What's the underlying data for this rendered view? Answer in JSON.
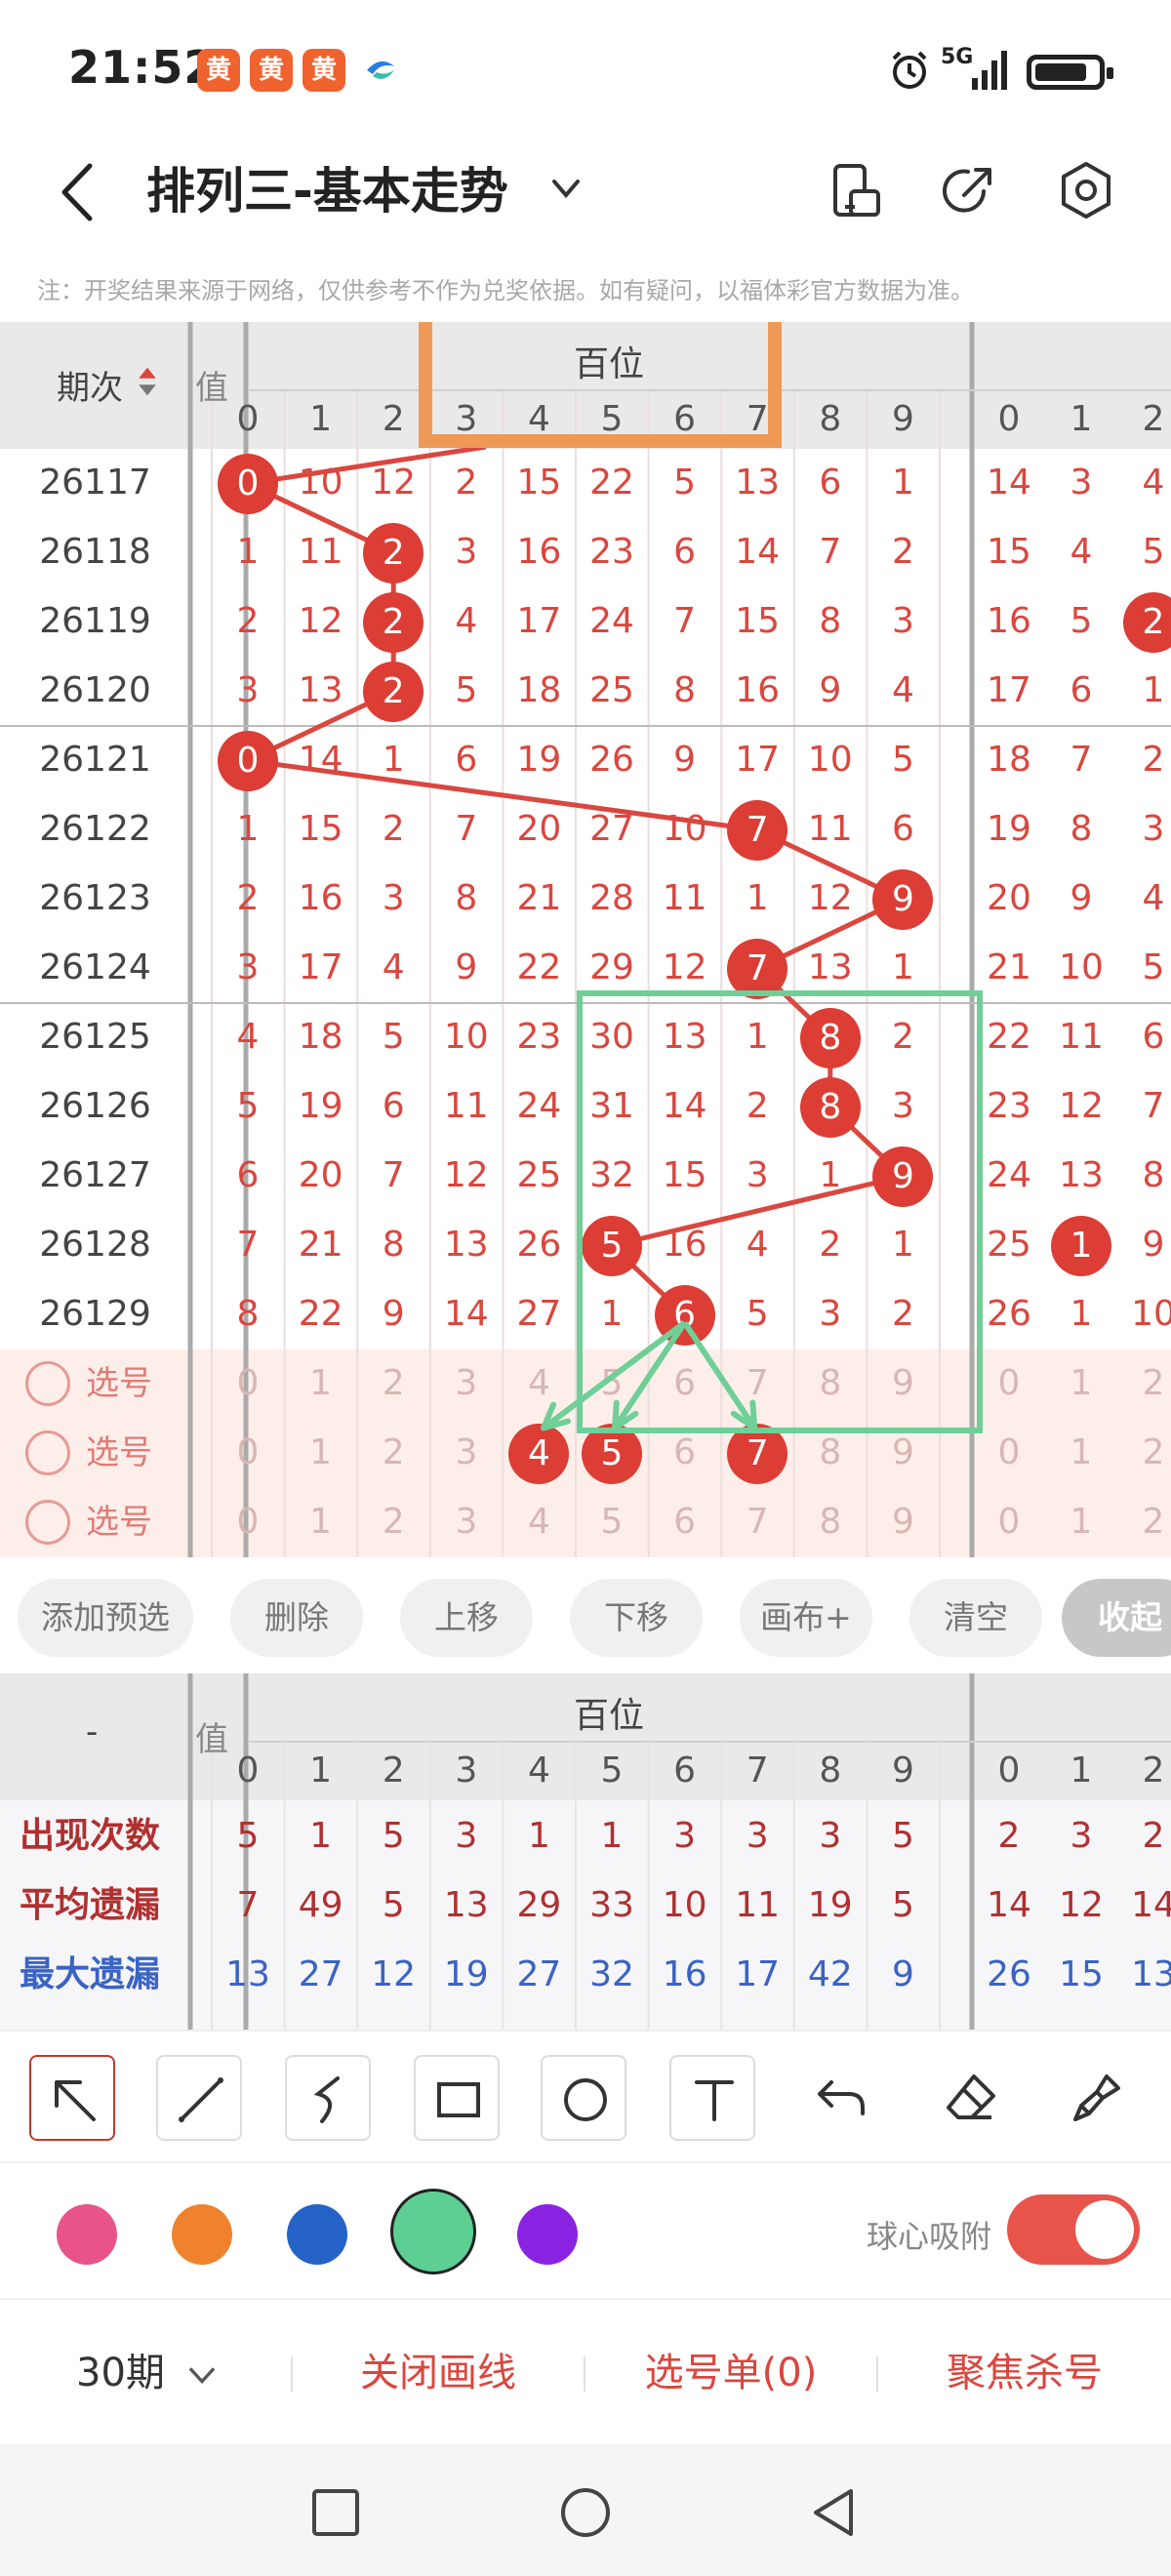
{
  "status": {
    "time": "21:52",
    "network": "5G",
    "app_icons": [
      "黄",
      "黄",
      "黄"
    ]
  },
  "header": {
    "title": "排列三-基本走势",
    "note": "注：开奖结果来源于网络，仅供参考不作为兑奖依据。如有疑问，以福体彩官方数据为准。"
  },
  "trend": {
    "period_header": "期次",
    "value_header_partial": "值",
    "group_header": "百位",
    "digits": [
      "0",
      "1",
      "2",
      "3",
      "4",
      "5",
      "6",
      "7",
      "8",
      "9"
    ],
    "next_digits": [
      "0",
      "1",
      "2"
    ],
    "rows": [
      {
        "period": "26117",
        "hundreds": [
          0,
          10,
          12,
          2,
          15,
          22,
          5,
          13,
          6,
          1
        ],
        "next": [
          14,
          3,
          4
        ],
        "hit": 0
      },
      {
        "period": "26118",
        "hundreds": [
          1,
          11,
          2,
          3,
          16,
          23,
          6,
          14,
          7,
          2
        ],
        "next": [
          15,
          4,
          5
        ],
        "hit": 2
      },
      {
        "period": "26119",
        "hundreds": [
          2,
          12,
          2,
          4,
          17,
          24,
          7,
          15,
          8,
          3
        ],
        "next": [
          16,
          5,
          2
        ],
        "hit": 2
      },
      {
        "period": "26120",
        "hundreds": [
          3,
          13,
          2,
          5,
          18,
          25,
          8,
          16,
          9,
          4
        ],
        "next": [
          17,
          6,
          1
        ],
        "hit": 2
      },
      {
        "period": "26121",
        "hundreds": [
          0,
          14,
          1,
          6,
          19,
          26,
          9,
          17,
          10,
          5
        ],
        "next": [
          18,
          7,
          2
        ],
        "hit": 0
      },
      {
        "period": "26122",
        "hundreds": [
          1,
          15,
          2,
          7,
          20,
          27,
          10,
          7,
          11,
          6
        ],
        "next": [
          19,
          8,
          3
        ],
        "hit": 7
      },
      {
        "period": "26123",
        "hundreds": [
          2,
          16,
          3,
          8,
          21,
          28,
          11,
          1,
          12,
          9
        ],
        "next": [
          20,
          9,
          4
        ],
        "hit": 9
      },
      {
        "period": "26124",
        "hundreds": [
          3,
          17,
          4,
          9,
          22,
          29,
          12,
          7,
          13,
          1
        ],
        "next": [
          21,
          10,
          5
        ],
        "hit": 7
      },
      {
        "period": "26125",
        "hundreds": [
          4,
          18,
          5,
          10,
          23,
          30,
          13,
          1,
          8,
          2
        ],
        "next": [
          22,
          11,
          6
        ],
        "hit": 8
      },
      {
        "period": "26126",
        "hundreds": [
          5,
          19,
          6,
          11,
          24,
          31,
          14,
          2,
          8,
          3
        ],
        "next": [
          23,
          12,
          7
        ],
        "hit": 8
      },
      {
        "period": "26127",
        "hundreds": [
          6,
          20,
          7,
          12,
          25,
          32,
          15,
          3,
          1,
          9
        ],
        "next": [
          24,
          13,
          8
        ],
        "hit": 9
      },
      {
        "period": "26128",
        "hundreds": [
          7,
          21,
          8,
          13,
          26,
          5,
          16,
          4,
          2,
          1
        ],
        "next": [
          25,
          1,
          9
        ],
        "hit": 5
      },
      {
        "period": "26129",
        "hundreds": [
          8,
          22,
          9,
          14,
          27,
          1,
          6,
          5,
          3,
          2
        ],
        "next": [
          26,
          1,
          10
        ],
        "hit": 6
      }
    ],
    "select_label": "选号",
    "select_rows": [
      {
        "balls": []
      },
      {
        "balls": [
          4,
          5,
          7
        ]
      },
      {
        "balls": []
      }
    ]
  },
  "actions": {
    "add_preselect": "添加预选",
    "delete": "删除",
    "move_up": "上移",
    "move_down": "下移",
    "canvas": "画布+",
    "clear": "清空",
    "collapse": "收起"
  },
  "stats": {
    "dash": "-",
    "value_header_partial": "值",
    "group_header": "百位",
    "rows": [
      {
        "label": "出现次数",
        "color": "#b03030",
        "values": [
          5,
          1,
          5,
          3,
          1,
          1,
          3,
          3,
          3,
          5
        ],
        "next": [
          2,
          3,
          2
        ]
      },
      {
        "label": "平均遗漏",
        "color": "#b03030",
        "values": [
          7,
          49,
          5,
          13,
          29,
          33,
          10,
          11,
          19,
          5
        ],
        "next": [
          14,
          12,
          14
        ]
      },
      {
        "label": "最大遗漏",
        "color": "#3a63c4",
        "values": [
          13,
          27,
          12,
          19,
          27,
          32,
          16,
          17,
          42,
          9
        ],
        "next": [
          26,
          15,
          13
        ]
      }
    ]
  },
  "draw": {
    "tools": [
      "arrow-tool",
      "line-tool",
      "curve-tool",
      "rect-tool",
      "circle-tool",
      "text-tool",
      "undo",
      "eraser",
      "brush"
    ],
    "colors": [
      "#e8548a",
      "#f0822d",
      "#2462c8",
      "#5dcf92",
      "#8a22e2"
    ],
    "selected_color": "#5dcf92",
    "snap_label": "球心吸附",
    "snap_on": true
  },
  "bottom": {
    "period_select": "30期",
    "close_lines": "关闭画线",
    "selection_list": "选号单(0)",
    "focus_kill": "聚焦杀号"
  }
}
